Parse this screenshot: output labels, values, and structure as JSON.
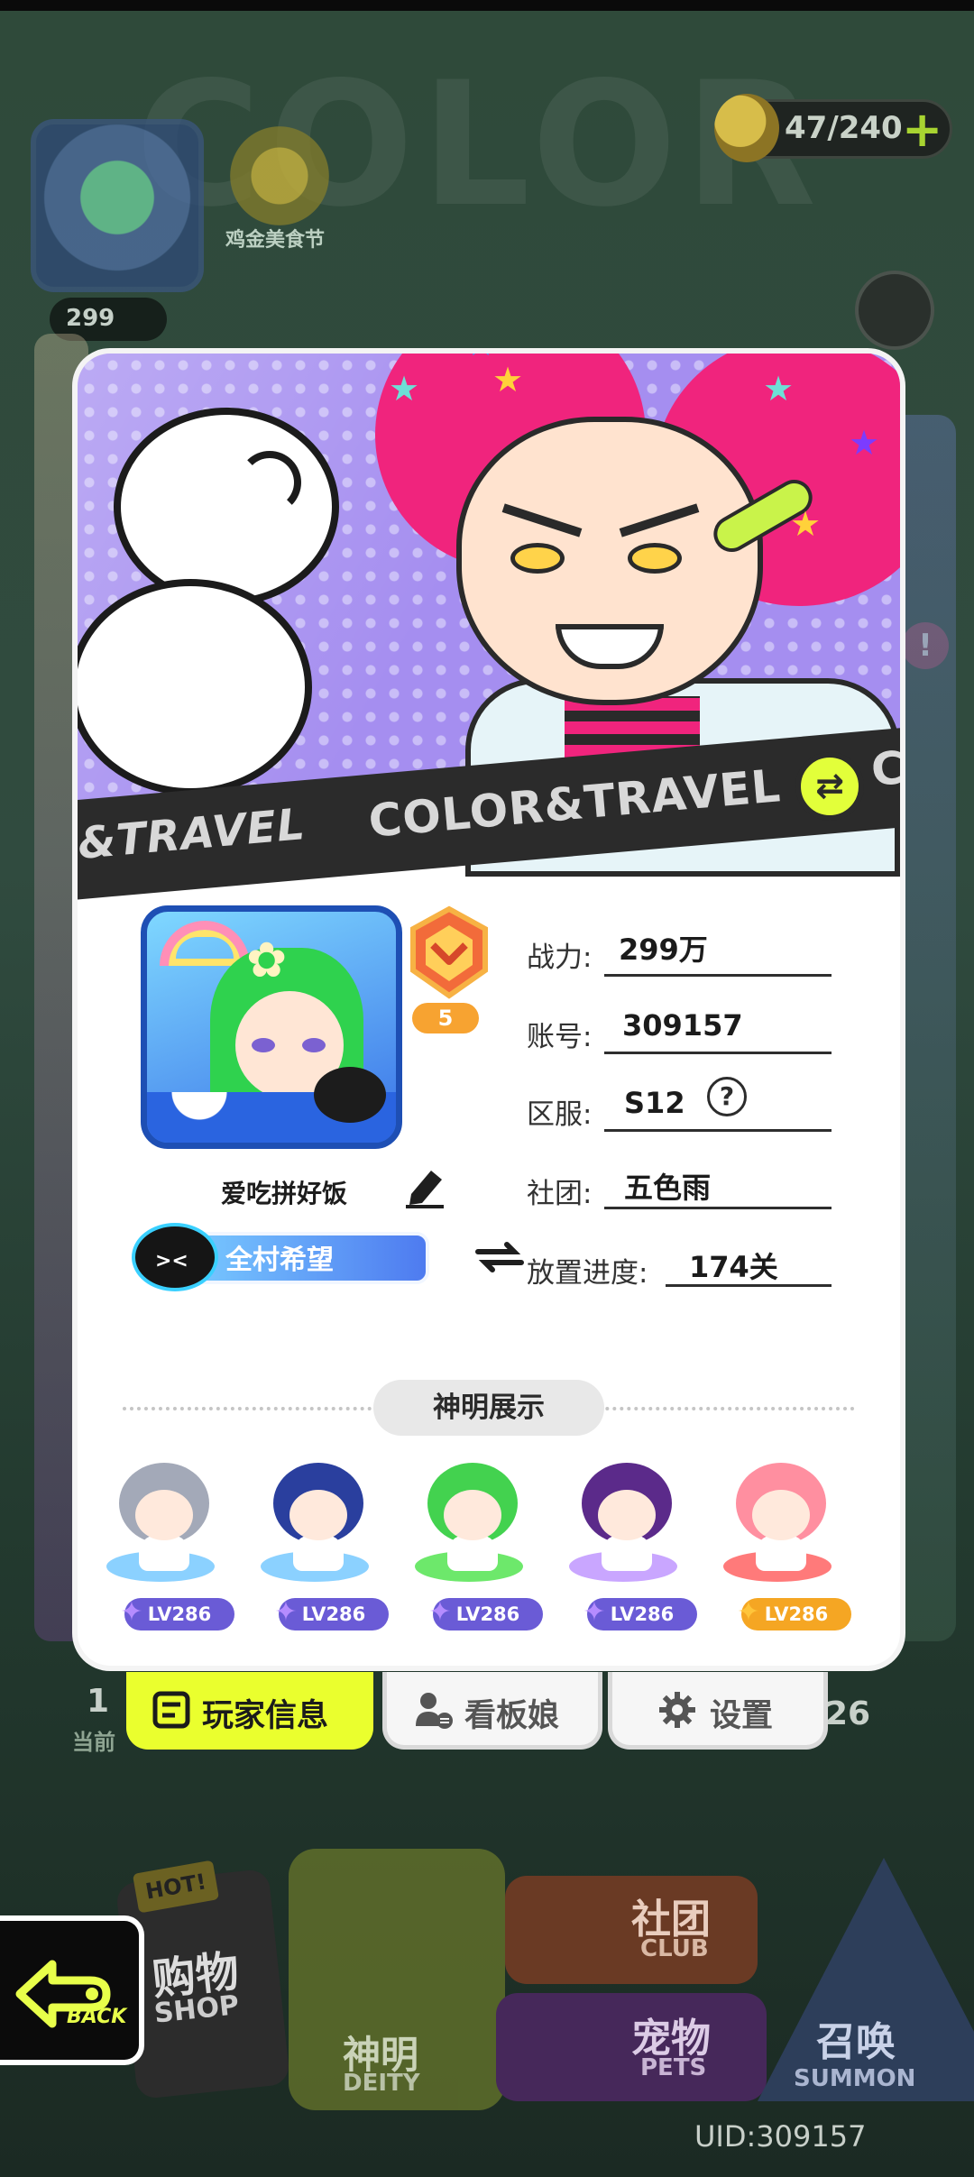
{
  "background": {
    "event_label": "鸡金美食节",
    "currency": "47/240",
    "power_tag": "299",
    "left_count": "1",
    "left_count_sub": "当前",
    "right_count": "26",
    "bg_word": "COLOR"
  },
  "menu": {
    "hot": "HOT!",
    "shop_cn": "购物",
    "shop_en": "SHOP",
    "deity_cn": "神明",
    "deity_en": "DEITY",
    "club_cn": "社团",
    "club_en": "CLUB",
    "pets_cn": "宠物",
    "pets_en": "PETS",
    "summon_cn": "召唤",
    "summon_en": "SUMMON",
    "back": "BACK"
  },
  "uid": "UID:309157",
  "banner": {
    "left_text": "&TRAVEL",
    "main_text": "COLOR&TRAVEL",
    "end_text": "CC"
  },
  "profile": {
    "rank_level": "5",
    "name": "爱吃拼好饭",
    "title": "全村希望",
    "rows": [
      {
        "label": "战力:",
        "value": "299万"
      },
      {
        "label": "账号:",
        "value": "309157"
      },
      {
        "label": "区服:",
        "value": "S12"
      },
      {
        "label": "社团:",
        "value": "五色雨"
      },
      {
        "label": "放置进度:",
        "value": "174关"
      }
    ]
  },
  "showcase": {
    "title": "神明展示",
    "deities": [
      {
        "level": "LV286",
        "hair": "#a3a9b8",
        "glow": "#8bd1ff",
        "pill": "#6a5bd6"
      },
      {
        "level": "LV286",
        "hair": "#2a3f9e",
        "glow": "#8bd1ff",
        "pill": "#6a5bd6"
      },
      {
        "level": "LV286",
        "hair": "#43d24f",
        "glow": "#6de86b",
        "pill": "#6a5bd6"
      },
      {
        "level": "LV286",
        "hair": "#5b2a8a",
        "glow": "#c9a6ff",
        "pill": "#6a5bd6"
      },
      {
        "level": "LV286",
        "hair": "#ff8fa0",
        "glow": "#ff7a7a",
        "pill": "#f5a623"
      }
    ]
  },
  "tabs": {
    "player_info": "玩家信息",
    "mascot": "看板娘",
    "settings": "设置"
  },
  "colors": {
    "accent": "#eaff2e",
    "card": "#ffffff",
    "hero_bg": "#a58ef0",
    "hair_pink": "#f0247d"
  }
}
